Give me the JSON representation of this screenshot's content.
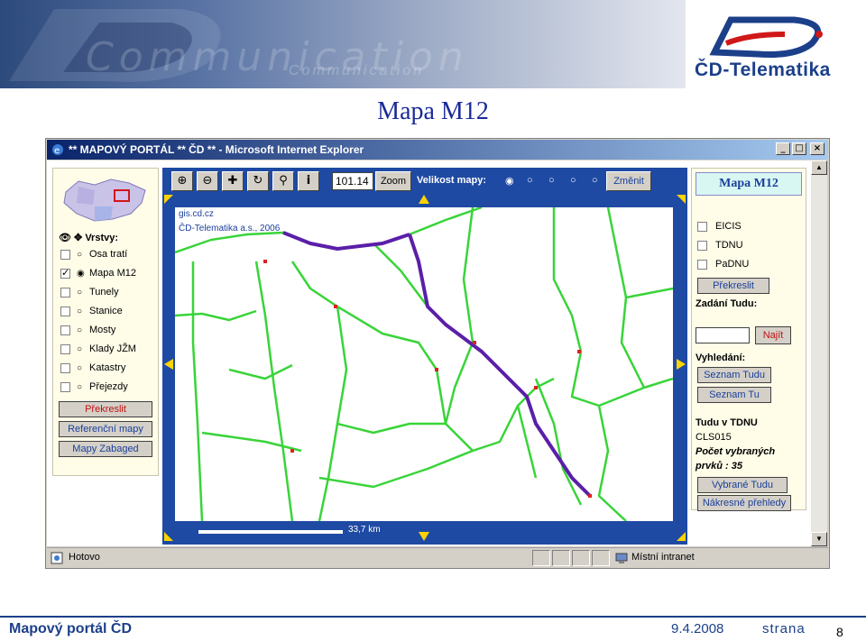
{
  "slide": {
    "title": "Mapa M12",
    "banner_watermark": "Communication",
    "banner_watermark_small": "Communication",
    "logo_text": "ČD-Telematika",
    "footer_left": "Mapový portál ČD",
    "footer_date": "9.4.2008",
    "footer_page_label": "strana",
    "footer_page_number": "8"
  },
  "window": {
    "title": "** MAPOVÝ PORTÁL ** ČD ** - Microsoft Internet Explorer",
    "status_text": "Hotovo",
    "zone_text": "Místní intranet"
  },
  "left_panel": {
    "layers_heading": "Vrstvy:",
    "layers": [
      {
        "label": "Osa tratí",
        "checked": false,
        "selected": false
      },
      {
        "label": "Mapa M12",
        "checked": true,
        "selected": true
      },
      {
        "label": "Tunely",
        "checked": false,
        "selected": false
      },
      {
        "label": "Stanice",
        "checked": false,
        "selected": false
      },
      {
        "label": "Mosty",
        "checked": false,
        "selected": false
      },
      {
        "label": "Klady JŽM",
        "checked": false,
        "selected": false
      },
      {
        "label": "Katastry",
        "checked": false,
        "selected": false
      },
      {
        "label": "Přejezdy",
        "checked": false,
        "selected": false
      }
    ],
    "btn_redraw": "Překreslit",
    "btn_reference": "Referenční mapy",
    "btn_zabaged": "Mapy Zabaged"
  },
  "map_toolbar": {
    "zoom_value": "101.14",
    "zoom_button": "Zoom",
    "size_label": "Velikost mapy:",
    "change_button": "Změnit"
  },
  "map": {
    "credit_url": "gis.cd.cz",
    "credit_company": "ČD-Telematika a.s., 2006",
    "scale_label": "33,7 km"
  },
  "right_panel": {
    "title": "Mapa M12",
    "checkboxes": [
      "EICIS",
      "TDNU",
      "PaDNU"
    ],
    "btn_redraw": "Překreslit",
    "input_label": "Zadání Tudu:",
    "btn_find": "Najít",
    "search_label": "Vyhledání:",
    "btn_list_tudu": "Seznam Tudu",
    "btn_list_tu": "Seznam Tu",
    "tudu_heading": "Tudu v TDNU",
    "tudu_code": "CLS015",
    "count_label_1": "Počet vybraných",
    "count_label_2": "prvků : 35",
    "btn_selected_tudu": "Vybrané Tudu",
    "btn_overview": "Nákresné přehledy"
  },
  "colors": {
    "map_frame": "#1f4aa3",
    "road_green": "#39d439",
    "route_purple": "#5a1fa8",
    "title_blue": "#1a2a9a"
  }
}
